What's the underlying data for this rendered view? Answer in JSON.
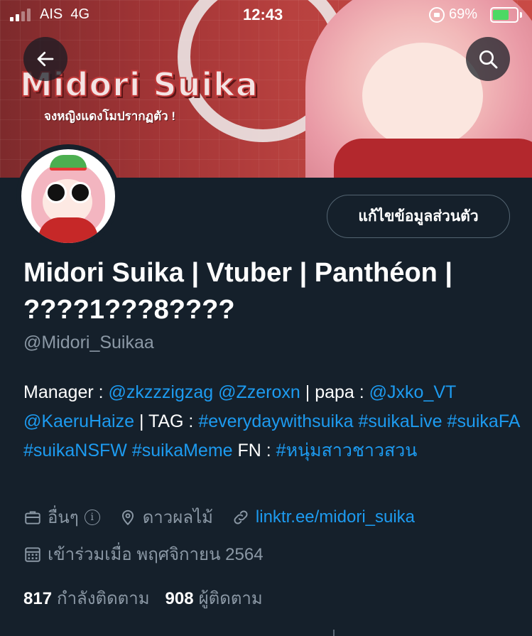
{
  "status_bar": {
    "carrier": "AIS",
    "network": "4G",
    "time": "12:43",
    "battery_percent": "69%",
    "battery_level": 0.69,
    "signal_bars": 2
  },
  "banner": {
    "title": "Midori Suika",
    "subtitle": "จงหญิงแดงโมปรากฏตัว !"
  },
  "icons": {
    "back": "arrow-left",
    "search": "magnifier",
    "category": "briefcase",
    "location": "map-pin",
    "website": "link",
    "joined": "calendar"
  },
  "profile": {
    "edit_label": "แก้ไขข้อมูลส่วนตัว",
    "display_name": "Midori Suika | Vtuber | Panthéon | ????1???8????",
    "handle": "@Midori_Suikaa",
    "bio": {
      "manager_label": "Manager : ",
      "manager_1": "@zkzzzigzag",
      "manager_2": "@Zzeroxn",
      "papa_label": " | papa : ",
      "papa_1": "@Jxko_VT",
      "papa_2": "@KaeruHaize",
      "tag_label": " | TAG : ",
      "tag": "#everydaywithsuika",
      "hashtag_1": "#suikaLive",
      "hashtag_2": "#suikaFA",
      "hashtag_3": "#suikaNSFW",
      "hashtag_4": "#suikaMeme",
      "fn_label": " FN : ",
      "fn_tag": "#หนุ่มสาวชาวสวน"
    },
    "category": "อื่นๆ",
    "info_glyph": "i",
    "location": "ดาวผลไม้",
    "website": "linktr.ee/midori_suika",
    "joined": "เข้าร่วมเมื่อ พฤศจิกายน 2564",
    "following_count": "817",
    "following_label": "กำลังติดตาม",
    "followers_count": "908",
    "followers_label": "ผู้ติดตาม"
  },
  "colors": {
    "background": "#15202b",
    "link": "#1d9bf0",
    "secondary_text": "#8b98a5",
    "battery_green": "#4cd964"
  }
}
